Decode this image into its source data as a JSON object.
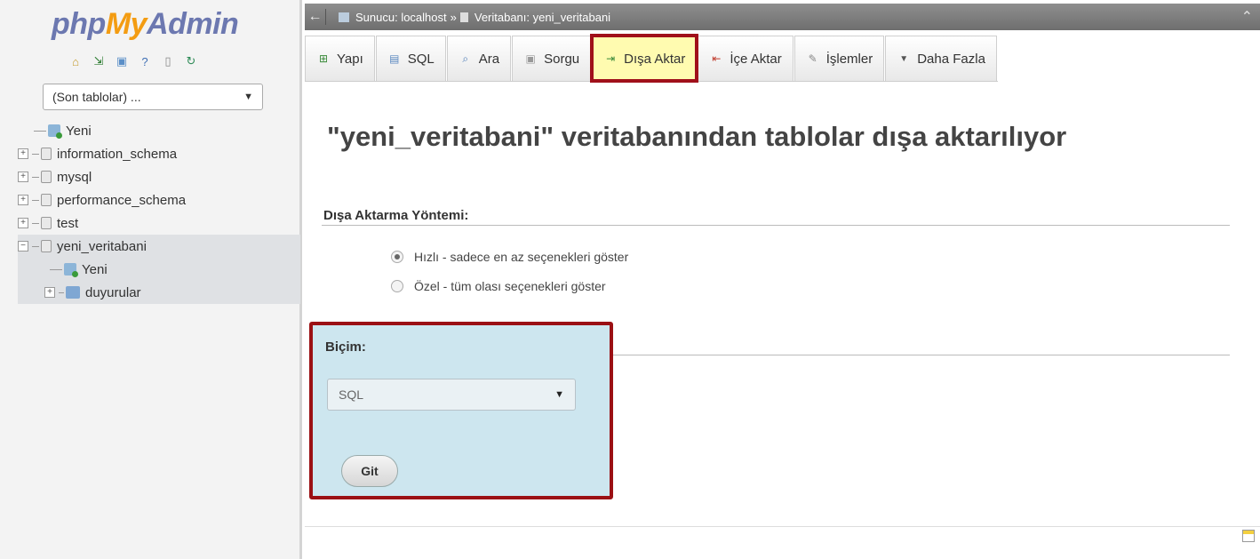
{
  "nav": {
    "logo": {
      "php": "php",
      "my": "My",
      "admin": "Admin"
    },
    "recent_select": "(Son tablolar) ...",
    "tree": [
      {
        "label": "Yeni",
        "type": "new"
      },
      {
        "label": "information_schema",
        "type": "db"
      },
      {
        "label": "mysql",
        "type": "db"
      },
      {
        "label": "performance_schema",
        "type": "db"
      },
      {
        "label": "test",
        "type": "db"
      },
      {
        "label": "yeni_veritabani",
        "type": "db",
        "active": true
      },
      {
        "label": "Yeni",
        "type": "new-child"
      },
      {
        "label": "duyurular",
        "type": "table-child"
      }
    ]
  },
  "topbar": {
    "server_label": "Sunucu: localhost",
    "separator": "»",
    "database_label": "Veritabanı: yeni_veritabani"
  },
  "tabs": [
    {
      "label": "Yapı",
      "icon": "structure-icon",
      "glyph": "⊞"
    },
    {
      "label": "SQL",
      "icon": "sql-icon",
      "glyph": "▤"
    },
    {
      "label": "Ara",
      "icon": "search-icon",
      "glyph": "⌕"
    },
    {
      "label": "Sorgu",
      "icon": "query-icon",
      "glyph": "▣"
    },
    {
      "label": "Dışa Aktar",
      "icon": "export-icon",
      "glyph": "⇥",
      "active": true
    },
    {
      "label": "İçe Aktar",
      "icon": "import-icon",
      "glyph": "⇤"
    },
    {
      "label": "İşlemler",
      "icon": "operations-icon",
      "glyph": "✎"
    },
    {
      "label": "Daha Fazla",
      "icon": "more-icon",
      "glyph": "▼"
    }
  ],
  "main": {
    "title": "\"yeni_veritabani\" veritabanından tablolar dışa aktarılıyor",
    "method_heading": "Dışa Aktarma Yöntemi:",
    "method_options": [
      {
        "label": "Hızlı - sadece en az seçenekleri göster",
        "checked": true
      },
      {
        "label": "Özel - tüm olası seçenekleri göster",
        "checked": false
      }
    ],
    "format_heading": "Biçim:",
    "format_value": "SQL",
    "go_label": "Git"
  },
  "colors": {
    "highlight_border": "#9b1014",
    "active_tab_bg": "#fffbb0",
    "format_box_bg": "#cde6ef"
  }
}
